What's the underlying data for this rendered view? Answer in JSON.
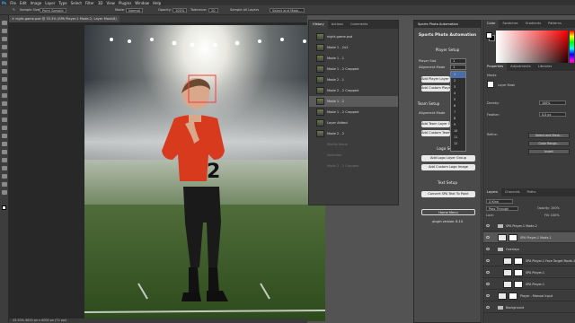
{
  "menubar": [
    "Ps",
    "File",
    "Edit",
    "Image",
    "Layer",
    "Type",
    "Select",
    "Filter",
    "3D",
    "View",
    "Plugins",
    "Window",
    "Help"
  ],
  "options": {
    "sample_size": "Sample Size:",
    "point_sample": "Point Sample",
    "opacity": "Opacity:",
    "opacity_val": "100%",
    "mode": "Mode:",
    "mode_val": "Normal",
    "tolerance": "Tolerance:",
    "tolerance_val": "20",
    "sample_all": "Sample All Layers",
    "select_mask": "Select and Mask..."
  },
  "doc_tab": "✕  night-game.psd @ 33.3% (SPA Player-1 Mode-2, Layer Mask/8)",
  "status": "33.33%   4000 px x 4000 px (72 ppi)",
  "history": {
    "tabs": [
      "History",
      "Actions",
      "Comments"
    ],
    "rows": [
      {
        "label": "night-game.psd",
        "state": "normal"
      },
      {
        "label": "Mode 1 - 2x2",
        "state": "normal"
      },
      {
        "label": "Mode 1 - 1",
        "state": "normal"
      },
      {
        "label": "Mode 1 - 2 Cropped",
        "state": "normal"
      },
      {
        "label": "Mode 2 - 1",
        "state": "normal"
      },
      {
        "label": "Mode 2 - 2 Cropped",
        "state": "normal"
      },
      {
        "label": "Mode 1 - 2",
        "state": "selected"
      },
      {
        "label": "Mode 1 - 2 Cropped",
        "state": "normal"
      },
      {
        "label": "Layer Added",
        "state": "normal"
      },
      {
        "label": "Mode 2 - 2",
        "state": "normal"
      },
      {
        "label": "Modify Mode",
        "state": "normal"
      },
      {
        "label": "Selection",
        "state": "normal"
      },
      {
        "label": "Mode 2 - 2 Cropped",
        "state": "normal"
      }
    ]
  },
  "spa": {
    "tab": "Sports Photo Automation",
    "title": "Sports Photo Automation",
    "player_setup": "Player Setup",
    "player_slot_label": "Player Slot",
    "player_slot_value": "1",
    "alignment_label": "Alignment Mode",
    "alignment_value": "1",
    "add_player": "Add Player Layer Group",
    "add_custom_player": "Add Custom Player Image",
    "team_setup": "Team Setup",
    "team_alignment": "Alignment Mode",
    "add_team": "Add Team Layer Group",
    "add_custom_team": "Add Custom Team Image",
    "logo_setup": "Logo Setup",
    "add_logo": "Add Logo Layer Group",
    "add_custom_logo": "Add Custom Logo Image",
    "text_setup": "Text Setup",
    "convert_text": "Convert SPA Text To Point",
    "home": "Home Menu",
    "version": "plugin version: 8.14",
    "dropdown": [
      "1",
      "2",
      "3",
      "4",
      "5",
      "6",
      "7",
      "8",
      "9",
      "10",
      "11",
      "12"
    ]
  },
  "color_panel": {
    "tabs": [
      "Color",
      "Swatches",
      "Gradients",
      "Patterns"
    ],
    "fg": "#ffffff",
    "bg": "#000000"
  },
  "properties": {
    "tabs": [
      "Properties",
      "Adjustments",
      "Libraries"
    ],
    "masks": "Masks",
    "layer_mask": "Layer Mask",
    "density": "Density:",
    "density_val": "100%",
    "feather": "Feather:",
    "feather_val": "0.0 px",
    "refine": "Refine:",
    "select_mask": "Select and Mask...",
    "color_range": "Color Range...",
    "invert": "Invert"
  },
  "layers": {
    "tabs": [
      "Layers",
      "Channels",
      "Paths"
    ],
    "kind": "Q Kind",
    "blend": "Pass Through",
    "opacity": "Opacity: 100%",
    "lock": "Lock:",
    "fill": "Fill: 100%",
    "rows": [
      {
        "name": "SPA Player-1 Mode-2",
        "type": "folder",
        "indent": 1,
        "sel": false
      },
      {
        "name": "SPA Player-1 Mode-1",
        "type": "layer",
        "indent": 1,
        "sel": true
      },
      {
        "name": "Overlays",
        "type": "folder",
        "indent": 1,
        "sel": false
      },
      {
        "name": "SPA Player-1 Face Target Mode-1",
        "type": "layer",
        "indent": 2,
        "sel": false
      },
      {
        "name": "SPA Player-1",
        "type": "layer",
        "indent": 2,
        "sel": false
      },
      {
        "name": "SPA Player-1",
        "type": "layer",
        "indent": 2,
        "sel": false
      },
      {
        "name": "Player - Manual Input",
        "type": "layer",
        "indent": 1,
        "sel": false
      },
      {
        "name": "Background",
        "type": "folder",
        "indent": 1,
        "sel": false
      }
    ]
  },
  "icons": {
    "face_target": "face-target-box",
    "jersey_number": "2"
  }
}
